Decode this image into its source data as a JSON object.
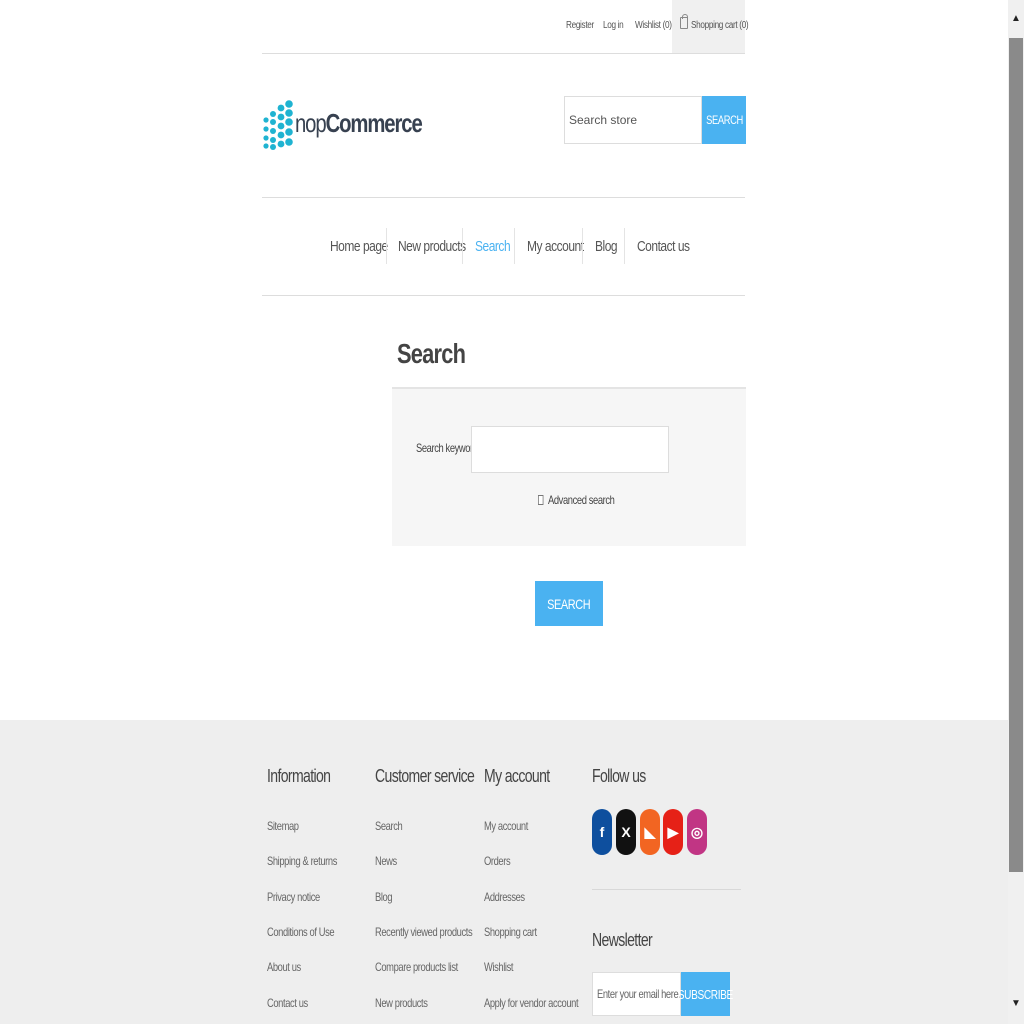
{
  "header": {
    "links": {
      "register": "Register",
      "login": "Log in",
      "wishlist": "Wishlist (0)",
      "cart": "Shopping cart (0)"
    }
  },
  "logo": {
    "text_light": "nop",
    "text_bold": "Commerce",
    "dot_color": "#1fb3d1"
  },
  "search_store": {
    "placeholder": "Search store",
    "button": "SEARCH"
  },
  "nav": {
    "items": [
      {
        "label": "Home page"
      },
      {
        "label": "New products"
      },
      {
        "label": "Search",
        "active": true
      },
      {
        "label": "My account"
      },
      {
        "label": "Blog"
      },
      {
        "label": "Contact us"
      }
    ]
  },
  "main": {
    "title": "Search",
    "keyword_label": "Search keyword:",
    "keyword_value": "",
    "advanced_label": "Advanced search",
    "advanced_checked": false,
    "search_button": "SEARCH"
  },
  "footer": {
    "information": {
      "title": "Information",
      "links": [
        "Sitemap",
        "Shipping & returns",
        "Privacy notice",
        "Conditions of Use",
        "About us",
        "Contact us"
      ]
    },
    "customer_service": {
      "title": "Customer service",
      "links": [
        "Search",
        "News",
        "Blog",
        "Recently viewed products",
        "Compare products list",
        "New products"
      ]
    },
    "my_account": {
      "title": "My account",
      "links": [
        "My account",
        "Orders",
        "Addresses",
        "Shopping cart",
        "Wishlist",
        "Apply for vendor account"
      ]
    },
    "follow_us": {
      "title": "Follow us",
      "icons": [
        {
          "name": "facebook-icon",
          "glyph": "f",
          "color": "#0e4f9e"
        },
        {
          "name": "x-icon",
          "glyph": "X",
          "color": "#111111"
        },
        {
          "name": "rss-icon",
          "glyph": "◣",
          "color": "#f26522"
        },
        {
          "name": "youtube-icon",
          "glyph": "▶",
          "color": "#e62117"
        },
        {
          "name": "instagram-icon",
          "glyph": "◎",
          "color": "#c13584"
        }
      ]
    },
    "newsletter": {
      "title": "Newsletter",
      "placeholder": "Enter your email here...",
      "button": "SUBSCRIBE"
    }
  },
  "colors": {
    "accent": "#4ab2f1",
    "footer_bg": "#eeeeee"
  }
}
